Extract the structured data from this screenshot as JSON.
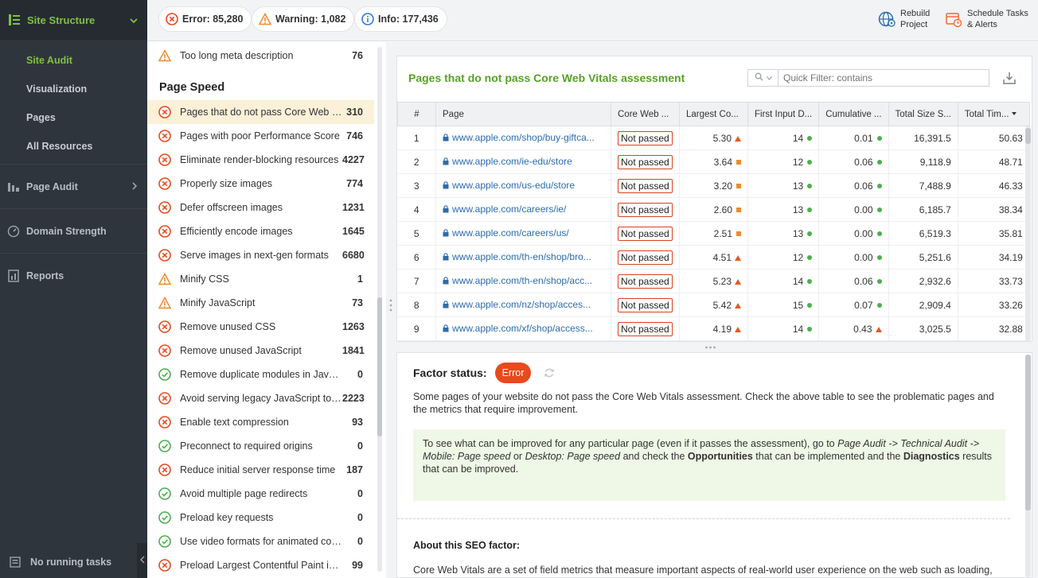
{
  "sidebar": {
    "header": "Site Structure",
    "sub_items": [
      "Site Audit",
      "Visualization",
      "Pages",
      "All Resources"
    ],
    "main_items": [
      "Page Audit",
      "Domain Strength",
      "Reports"
    ],
    "footer": "No running tasks"
  },
  "topbar": {
    "error": "Error: 85,280",
    "warning": "Warning: 1,082",
    "info": "Info: 177,436",
    "rebuild_line1": "Rebuild",
    "rebuild_line2": "Project",
    "schedule_line1": "Schedule Tasks",
    "schedule_line2": "& Alerts"
  },
  "left_list": {
    "section_title": "Page Speed",
    "top_item": {
      "label": "Too long meta description",
      "count": "76"
    },
    "items": [
      {
        "label": "Pages that do not pass Core Web Vi...",
        "count": "310",
        "status": "error"
      },
      {
        "label": "Pages with poor Performance Score",
        "count": "746",
        "status": "error"
      },
      {
        "label": "Eliminate render-blocking resources",
        "count": "4227",
        "status": "error"
      },
      {
        "label": "Properly size images",
        "count": "774",
        "status": "error"
      },
      {
        "label": "Defer offscreen images",
        "count": "1231",
        "status": "error"
      },
      {
        "label": "Efficiently encode images",
        "count": "1645",
        "status": "error"
      },
      {
        "label": "Serve images in next-gen formats",
        "count": "6680",
        "status": "error"
      },
      {
        "label": "Minify CSS",
        "count": "1",
        "status": "warning"
      },
      {
        "label": "Minify JavaScript",
        "count": "73",
        "status": "warning"
      },
      {
        "label": "Remove unused CSS",
        "count": "1263",
        "status": "error"
      },
      {
        "label": "Remove unused JavaScript",
        "count": "1841",
        "status": "error"
      },
      {
        "label": "Remove duplicate modules in JavaScri...",
        "count": "0",
        "status": "ok"
      },
      {
        "label": "Avoid serving legacy JavaScript to ...",
        "count": "2223",
        "status": "error"
      },
      {
        "label": "Enable text compression",
        "count": "93",
        "status": "error"
      },
      {
        "label": "Preconnect to required origins",
        "count": "0",
        "status": "ok"
      },
      {
        "label": "Reduce initial server response time",
        "count": "187",
        "status": "error"
      },
      {
        "label": "Avoid multiple page redirects",
        "count": "0",
        "status": "ok"
      },
      {
        "label": "Preload key requests",
        "count": "0",
        "status": "ok"
      },
      {
        "label": "Use video formats for animated content",
        "count": "0",
        "status": "ok"
      },
      {
        "label": "Preload Largest Contentful Paint ima...",
        "count": "99",
        "status": "error"
      }
    ]
  },
  "table": {
    "title": "Pages that do not pass Core Web Vitals assessment",
    "filter_placeholder": "Quick Filter: contains",
    "columns": [
      "#",
      "Page",
      "Core Web ...",
      "Largest Co...",
      "First Input D...",
      "Cumulative ...",
      "Total Size S...",
      "Total Tim..."
    ],
    "rows": [
      {
        "n": "1",
        "page": "www.apple.com/shop/buy-giftca...",
        "status": "Not passed",
        "lcp": "5.30",
        "lcp_m": "tri",
        "fid": "14",
        "cls": "0.01",
        "cls_m": "dot",
        "size": "16,391.5",
        "time": "50.63"
      },
      {
        "n": "2",
        "page": "www.apple.com/ie-edu/store",
        "status": "Not passed",
        "lcp": "3.64",
        "lcp_m": "sq",
        "fid": "12",
        "cls": "0.06",
        "cls_m": "dot",
        "size": "9,118.9",
        "time": "48.71"
      },
      {
        "n": "3",
        "page": "www.apple.com/us-edu/store",
        "status": "Not passed",
        "lcp": "3.20",
        "lcp_m": "sq",
        "fid": "13",
        "cls": "0.06",
        "cls_m": "dot",
        "size": "7,488.9",
        "time": "46.33"
      },
      {
        "n": "4",
        "page": "www.apple.com/careers/ie/",
        "status": "Not passed",
        "lcp": "2.60",
        "lcp_m": "sq",
        "fid": "13",
        "cls": "0.00",
        "cls_m": "dot",
        "size": "6,185.7",
        "time": "38.34"
      },
      {
        "n": "5",
        "page": "www.apple.com/careers/us/",
        "status": "Not passed",
        "lcp": "2.51",
        "lcp_m": "sq",
        "fid": "13",
        "cls": "0.00",
        "cls_m": "dot",
        "size": "6,519.3",
        "time": "35.81"
      },
      {
        "n": "6",
        "page": "www.apple.com/th-en/shop/bro...",
        "status": "Not passed",
        "lcp": "4.51",
        "lcp_m": "tri",
        "fid": "12",
        "cls": "0.00",
        "cls_m": "dot",
        "size": "5,251.6",
        "time": "34.19"
      },
      {
        "n": "7",
        "page": "www.apple.com/th-en/shop/acc...",
        "status": "Not passed",
        "lcp": "5.23",
        "lcp_m": "tri",
        "fid": "14",
        "cls": "0.06",
        "cls_m": "dot",
        "size": "2,932.6",
        "time": "33.73"
      },
      {
        "n": "8",
        "page": "www.apple.com/nz/shop/acces...",
        "status": "Not passed",
        "lcp": "5.42",
        "lcp_m": "tri",
        "fid": "15",
        "cls": "0.07",
        "cls_m": "dot",
        "size": "2,909.4",
        "time": "33.26"
      },
      {
        "n": "9",
        "page": "www.apple.com/xf/shop/access...",
        "status": "Not passed",
        "lcp": "4.19",
        "lcp_m": "tri",
        "fid": "14",
        "cls": "0.43",
        "cls_m": "tri",
        "size": "3,025.5",
        "time": "32.88"
      }
    ]
  },
  "detail": {
    "factor_label": "Factor status:",
    "badge": "Error",
    "description": "Some pages of your website do not pass the Core Web Vitals assessment. Check the above table to see the problematic pages and the metrics that require improvement.",
    "hint_1": "To see what can be improved for any particular page (even if it passes the assessment), go to ",
    "hint_em1": "Page Audit -> Technical Audit -> Mobile: Page speed",
    "hint_2": " or ",
    "hint_em2": "Desktop: Page speed",
    "hint_3": " and check the ",
    "hint_b1": "Opportunities",
    "hint_4": " that can be implemented and the ",
    "hint_b2": "Diagnostics",
    "hint_5": " results that can be improved.",
    "about_title": "About this SEO factor:",
    "about_text": "Core Web Vitals are a set of field metrics that measure important aspects of real-world user experience on the web such as loading,"
  },
  "colors": {
    "accent_green": "#7ec242",
    "error": "#e8491d",
    "link": "#2b6cb0"
  }
}
